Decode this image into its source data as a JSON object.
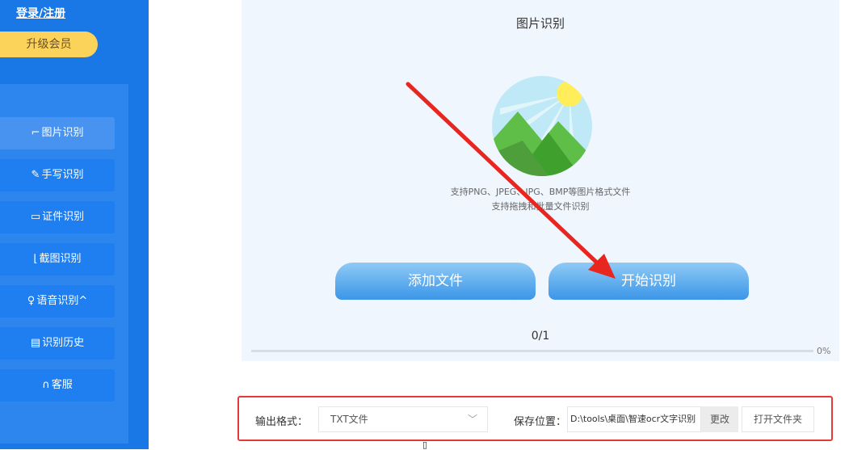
{
  "sidebar": {
    "login_label": "登录/注册",
    "vip_label": "升级会员",
    "items": [
      {
        "icon": "image-icon",
        "glyph": "⌐",
        "label": "图片识别",
        "active": true
      },
      {
        "icon": "pen-icon",
        "glyph": "✎",
        "label": "手写识别",
        "active": false
      },
      {
        "icon": "id-card-icon",
        "glyph": "▭",
        "label": "证件识别",
        "active": false
      },
      {
        "icon": "crop-icon",
        "glyph": "⌊",
        "label": "截图识别",
        "active": false
      },
      {
        "icon": "microphone-icon",
        "glyph": "♀",
        "label": "语音识别^",
        "active": false
      },
      {
        "icon": "history-icon",
        "glyph": "▤",
        "label": "识别历史",
        "active": false
      },
      {
        "icon": "headset-icon",
        "glyph": "∩",
        "label": "客服",
        "active": false
      }
    ]
  },
  "upload": {
    "title": "图片识别",
    "support_line1": "支持PNG、JPEG、JPG、BMP等图片格式文件",
    "support_line2": "支持拖拽和批量文件识别",
    "add_button": "添加文件",
    "start_button": "开始识别",
    "progress_text": "0/1",
    "progress_percent": "0%",
    "progress_value": 0
  },
  "settings": {
    "format_label": "输出格式：",
    "format_value": "TXT文件",
    "save_label": "保存位置：",
    "save_path": "D:\\tools\\桌面\\智速ocr文字识别",
    "change_button": "更改",
    "open_folder_button": "打开文件夹"
  },
  "colors": {
    "sidebar": "#1a78e6",
    "accent_yellow": "#fcd35a",
    "highlight_red": "#e53935",
    "annotation_arrow": "#e8261f"
  },
  "cursor_glyph": "▯"
}
